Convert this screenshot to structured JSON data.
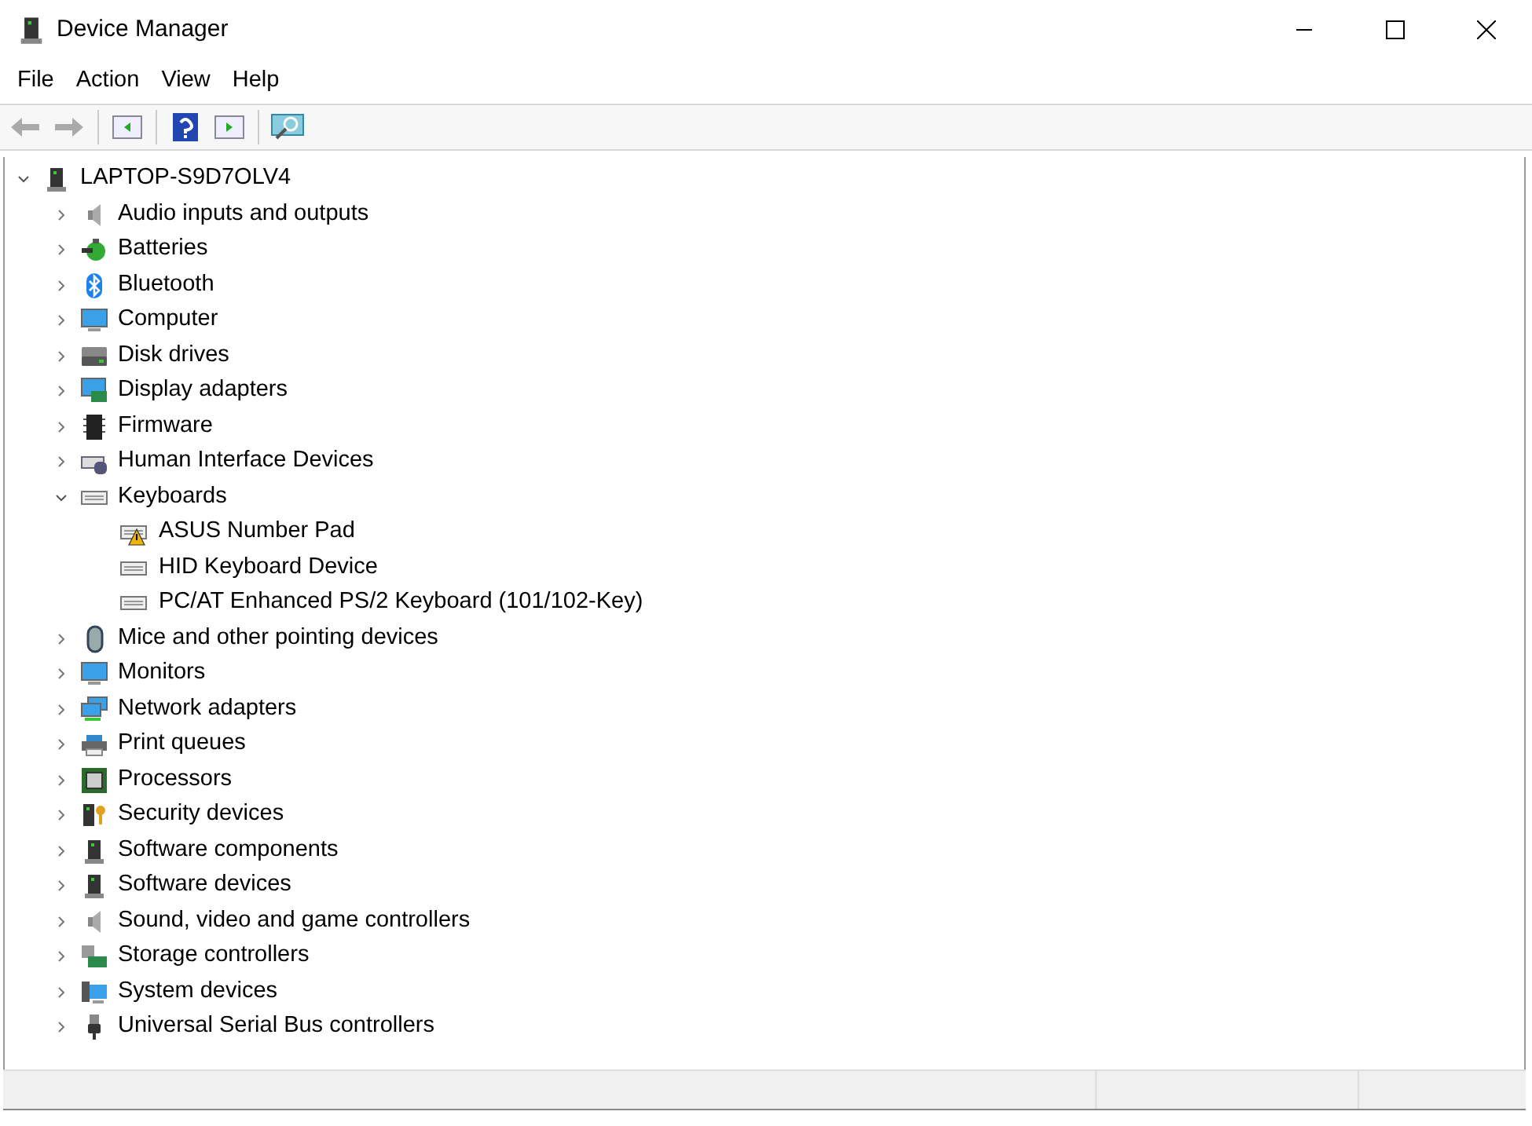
{
  "window": {
    "title": "Device Manager"
  },
  "menu": [
    "File",
    "Action",
    "View",
    "Help"
  ],
  "tree": {
    "label": "LAPTOP-S9D7OLV4",
    "expanded": true,
    "children": [
      {
        "label": "Audio inputs and outputs",
        "expanded": false
      },
      {
        "label": "Batteries",
        "expanded": false
      },
      {
        "label": "Bluetooth",
        "expanded": false
      },
      {
        "label": "Computer",
        "expanded": false
      },
      {
        "label": "Disk drives",
        "expanded": false
      },
      {
        "label": "Display adapters",
        "expanded": false
      },
      {
        "label": "Firmware",
        "expanded": false
      },
      {
        "label": "Human Interface Devices",
        "expanded": false
      },
      {
        "label": "Keyboards",
        "expanded": true,
        "children": [
          {
            "label": "ASUS Number Pad",
            "warning": true
          },
          {
            "label": "HID Keyboard Device",
            "warning": false
          },
          {
            "label": "PC/AT Enhanced PS/2 Keyboard (101/102-Key)",
            "warning": false
          }
        ]
      },
      {
        "label": "Mice and other pointing devices",
        "expanded": false
      },
      {
        "label": "Monitors",
        "expanded": false
      },
      {
        "label": "Network adapters",
        "expanded": false
      },
      {
        "label": "Print queues",
        "expanded": false
      },
      {
        "label": "Processors",
        "expanded": false
      },
      {
        "label": "Security devices",
        "expanded": false
      },
      {
        "label": "Software components",
        "expanded": false
      },
      {
        "label": "Software devices",
        "expanded": false
      },
      {
        "label": "Sound, video and game controllers",
        "expanded": false
      },
      {
        "label": "Storage controllers",
        "expanded": false
      },
      {
        "label": "System devices",
        "expanded": false
      },
      {
        "label": "Universal Serial Bus controllers",
        "expanded": false
      }
    ]
  }
}
